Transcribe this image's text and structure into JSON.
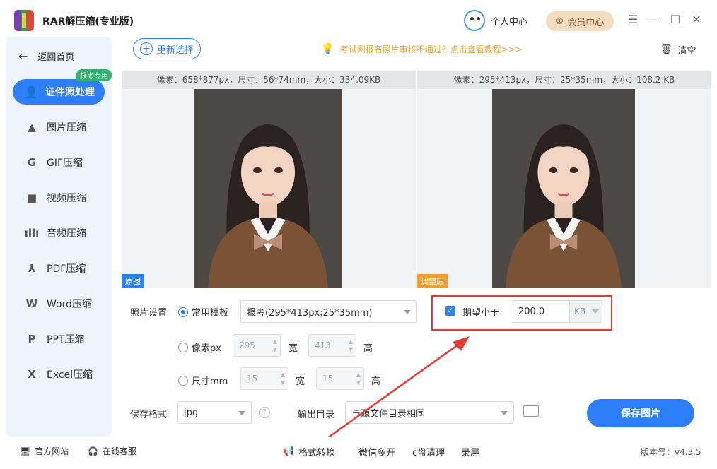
{
  "app": {
    "title": "RAR解压缩(专业版)"
  },
  "header": {
    "personal_center": "个人中心",
    "vip_center": "会员中心"
  },
  "sidebar": {
    "back": "返回首页",
    "active": {
      "label": "证件照处理",
      "badge": "报考专用"
    },
    "items": [
      {
        "label": "图片压缩",
        "icon": "image-icon"
      },
      {
        "label": "GIF压缩",
        "icon": "gif-icon"
      },
      {
        "label": "视频压缩",
        "icon": "video-icon"
      },
      {
        "label": "音频压缩",
        "icon": "audio-icon"
      },
      {
        "label": "PDF压缩",
        "icon": "pdf-icon"
      },
      {
        "label": "Word压缩",
        "icon": "word-icon"
      },
      {
        "label": "PPT压缩",
        "icon": "ppt-icon"
      },
      {
        "label": "Excel压缩",
        "icon": "excel-icon"
      }
    ]
  },
  "toolbar": {
    "reselect": "重新选择",
    "tip": "考试网报名照片审核不通过？点击查看教程>>>",
    "clear": "清空"
  },
  "preview": {
    "original": {
      "info": "像素：658*877px，尺寸：56*74mm，大小：334.09KB",
      "tag": "原图"
    },
    "adjusted": {
      "info": "像素：295*413px，尺寸：25*35mm，大小：108.2 KB",
      "tag": "调整后"
    }
  },
  "settings": {
    "photo_settings_label": "照片设置",
    "template_option": "常用模板",
    "template_value": "报考(295*413px;25*35mm)",
    "pixel_option": "像素px",
    "pixel_width": "295",
    "pixel_height": "413",
    "size_option": "尺寸mm",
    "size_width": "15",
    "size_height": "15",
    "width_label": "宽",
    "height_label": "高",
    "expect_less_than": "期望小于",
    "target_size": "200.0",
    "target_unit": "KB",
    "save_format_label": "保存格式",
    "save_format": "jpg",
    "output_dir_label": "输出目录",
    "output_dir": "与源文件目录相同",
    "save_button": "保存图片"
  },
  "footer": {
    "website": "官方网站",
    "support": "在线客服",
    "format_convert": "格式转换",
    "wechat_multi": "微信多开",
    "c_clean": "c盘清理",
    "record": "录屏",
    "version": "版本号：v4.3.5"
  },
  "colors": {
    "accent": "#2d7ff9",
    "highlight_box": "#e53935",
    "tip": "#e9a52b",
    "vip_bg": "#f4dcc0"
  }
}
